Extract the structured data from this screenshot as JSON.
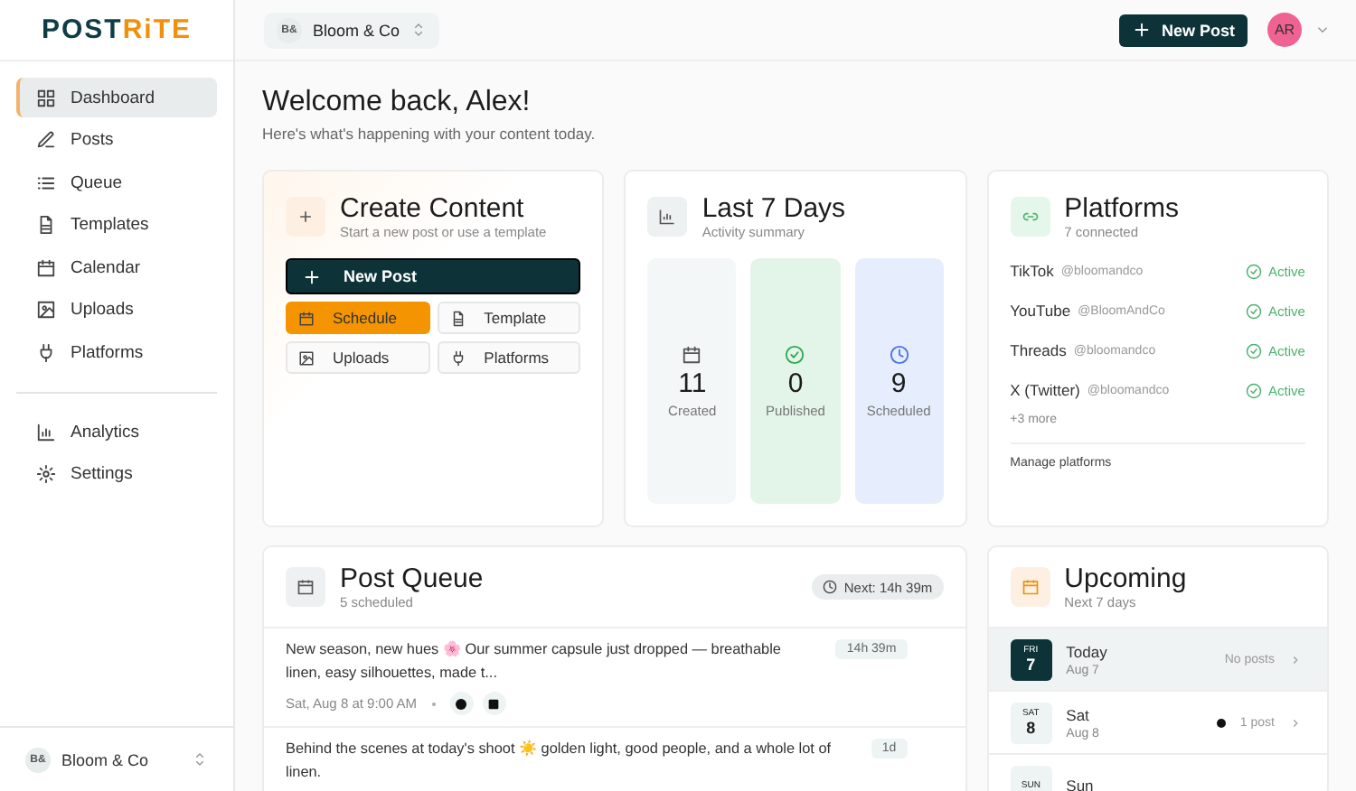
{
  "logo": {
    "first": "POST",
    "second": "RiTE"
  },
  "sidebar": {
    "items": [
      {
        "label": "Dashboard",
        "selected": true
      },
      {
        "label": "Posts",
        "selected": false
      },
      {
        "label": "Queue",
        "selected": false
      },
      {
        "label": "Templates",
        "selected": false
      },
      {
        "label": "Calendar",
        "selected": false
      },
      {
        "label": "Uploads",
        "selected": false
      },
      {
        "label": "Platforms",
        "selected": false
      }
    ],
    "secondary_items": [
      {
        "label": "Analytics",
        "selected": false
      },
      {
        "label": "Settings",
        "selected": false
      }
    ],
    "workspace": {
      "initials": "B&",
      "name": "Bloom & Co"
    }
  },
  "topbar": {
    "workspace": {
      "initials": "B&",
      "name": "Bloom & Co"
    },
    "new_post": "New Post",
    "avatar": "AR"
  },
  "welcome": {
    "title": "Welcome back, Alex!",
    "subtitle": "Here's what's happening with your content today."
  },
  "create": {
    "title": "Create Content",
    "subtitle": "Start a new post or use a template",
    "primary": "New Post",
    "actions": [
      {
        "label": "Schedule",
        "kind": "accent"
      },
      {
        "label": "Template",
        "kind": "plain"
      },
      {
        "label": "Uploads",
        "kind": "plain"
      },
      {
        "label": "Platforms",
        "kind": "plain"
      }
    ]
  },
  "activity": {
    "title": "Last 7 Days",
    "subtitle": "Activity summary",
    "stats": [
      {
        "value": "11",
        "label": "Created",
        "color": "#f3f7f7"
      },
      {
        "value": "0",
        "label": "Published",
        "color": "#e3f5e8"
      },
      {
        "value": "9",
        "label": "Scheduled",
        "color": "#e6eefd"
      }
    ]
  },
  "platforms": {
    "title": "Platforms",
    "subtitle": "7 connected",
    "items": [
      {
        "name": "TikTok",
        "handle": "@bloomandco",
        "status": "Active"
      },
      {
        "name": "YouTube",
        "handle": "@BloomAndCo",
        "status": "Active"
      },
      {
        "name": "Threads",
        "handle": "@bloomandco",
        "status": "Active"
      },
      {
        "name": "X (Twitter)",
        "handle": "@bloomandco",
        "status": "Active"
      }
    ],
    "more": "+3 more",
    "manage": "Manage platforms"
  },
  "queue": {
    "title": "Post Queue",
    "subtitle": "5 scheduled",
    "next": "Next: 14h 39m",
    "posts": [
      {
        "text": "New season, new hues 🌸 Our summer capsule just dropped — breathable linen, easy silhouettes, made t...",
        "eta": "14h 39m",
        "when": "Sat, Aug 8 at 9:00 AM"
      },
      {
        "text": "Behind the scenes at today's shoot ☀️ golden light, good people, and a whole lot of linen.",
        "eta": "1d"
      }
    ]
  },
  "upcoming": {
    "title": "Upcoming",
    "subtitle": "Next 7 days",
    "days": [
      {
        "dow": "FRI",
        "num": "7",
        "label": "Today",
        "date": "Aug 7",
        "summary": "No posts",
        "has_posts": false,
        "selected": true
      },
      {
        "dow": "SAT",
        "num": "8",
        "label": "Sat",
        "date": "Aug 8",
        "summary": "1 post",
        "has_posts": true,
        "selected": false
      },
      {
        "dow": "SUN",
        "label": "Sun",
        "selected": false
      }
    ]
  }
}
